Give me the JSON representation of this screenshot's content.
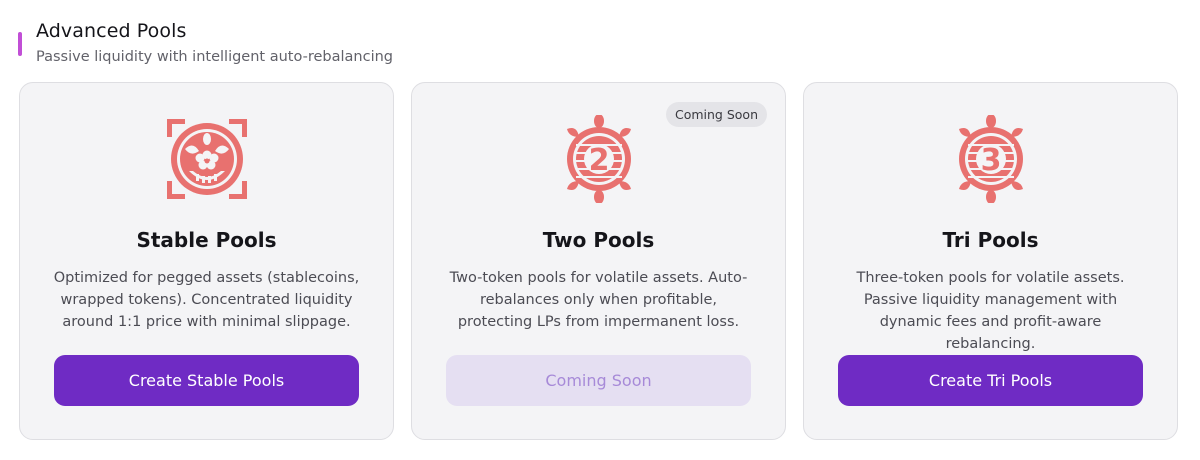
{
  "section": {
    "title": "Advanced Pools",
    "subtitle": "Passive liquidity with intelligent auto-rebalancing",
    "accent_color": "#c14fd6"
  },
  "cards": [
    {
      "icon": "stable-pool-emblem-icon",
      "title": "Stable Pools",
      "description": "Optimized for pegged assets (stablecoins, wrapped tokens). Concentrated liquidity around 1:1 price with minimal slippage.",
      "button_label": "Create Stable Pools",
      "button_state": "enabled"
    },
    {
      "icon": "two-pool-emblem-icon",
      "icon_numeral": "2",
      "badge": "Coming Soon",
      "title": "Two Pools",
      "description": "Two-token pools for volatile assets. Auto-rebalances only when profitable, protecting LPs from impermanent loss.",
      "button_label": "Coming Soon",
      "button_state": "disabled"
    },
    {
      "icon": "tri-pool-emblem-icon",
      "icon_numeral": "3",
      "title": "Tri Pools",
      "description": "Three-token pools for volatile assets. Passive liquidity management with dynamic fees and profit-aware rebalancing.",
      "button_label": "Create Tri Pools",
      "button_state": "enabled"
    }
  ],
  "colors": {
    "icon_coral": "#e8716f",
    "primary_button": "#6f2bc4",
    "disabled_button": "#e5dff2",
    "disabled_text": "#a78ad8",
    "card_background": "#f4f4f6"
  }
}
